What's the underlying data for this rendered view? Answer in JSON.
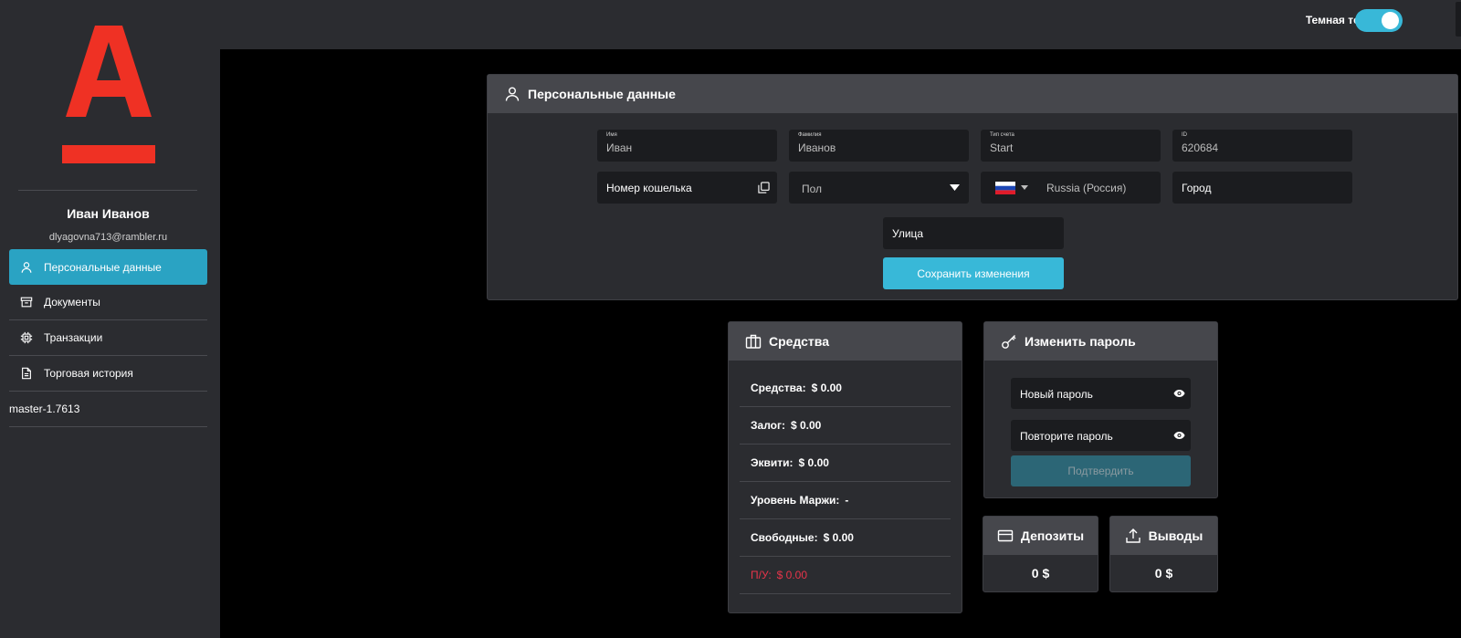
{
  "sidebar": {
    "logo": "alfa-a-logo",
    "user_name": "Иван  Иванов",
    "user_email": "dlyagovna713@rambler.ru",
    "items": [
      {
        "label": "Персональные данные",
        "icon": "user-icon",
        "active": true
      },
      {
        "label": "Документы",
        "icon": "archive-icon",
        "active": false
      },
      {
        "label": "Транзакции",
        "icon": "cpu-icon",
        "active": false
      },
      {
        "label": "Торговая история",
        "icon": "document-icon",
        "active": false
      }
    ],
    "version": "master-1.7613"
  },
  "topbar": {
    "theme_label": "Темная тема",
    "theme_on": true
  },
  "personal": {
    "title": "Персональные данные",
    "first_name_label": "Имя",
    "first_name": "Иван",
    "last_name_label": "Фамилия",
    "last_name": "Иванов",
    "account_type_label": "Тип счета",
    "account_type": "Start",
    "id_label": "ID",
    "id": "620684",
    "wallet_placeholder": "Номер кошелька",
    "gender_placeholder": "Пол",
    "country": "Russia (Россия)",
    "city_placeholder": "Город",
    "street_placeholder": "Улица",
    "save_label": "Сохранить изменения"
  },
  "funds": {
    "title": "Средства",
    "rows": [
      {
        "label": "Средства:",
        "value": "$ 0.00"
      },
      {
        "label": "Залог:",
        "value": "$ 0.00"
      },
      {
        "label": "Эквити:",
        "value": "$ 0.00"
      },
      {
        "label": "Уровень Маржи:",
        "value": "-"
      },
      {
        "label": "Свободные:",
        "value": "$ 0.00"
      },
      {
        "label": "П/У:",
        "value": "$ 0.00"
      }
    ]
  },
  "password": {
    "title": "Изменить пароль",
    "new_placeholder": "Новый пароль",
    "repeat_placeholder": "Повторите пароль",
    "confirm_label": "Подтвердить"
  },
  "deposits": {
    "title": "Депозиты",
    "amount": "0 $"
  },
  "withdrawals": {
    "title": "Выводы",
    "amount": "0 $"
  },
  "colors": {
    "accent": "#38b8d8",
    "active_nav": "#2aa3c3",
    "logo_red": "#ef3124",
    "loss_red": "#e8344a",
    "panel": "#2b2c30",
    "panel_header": "#46474c"
  }
}
